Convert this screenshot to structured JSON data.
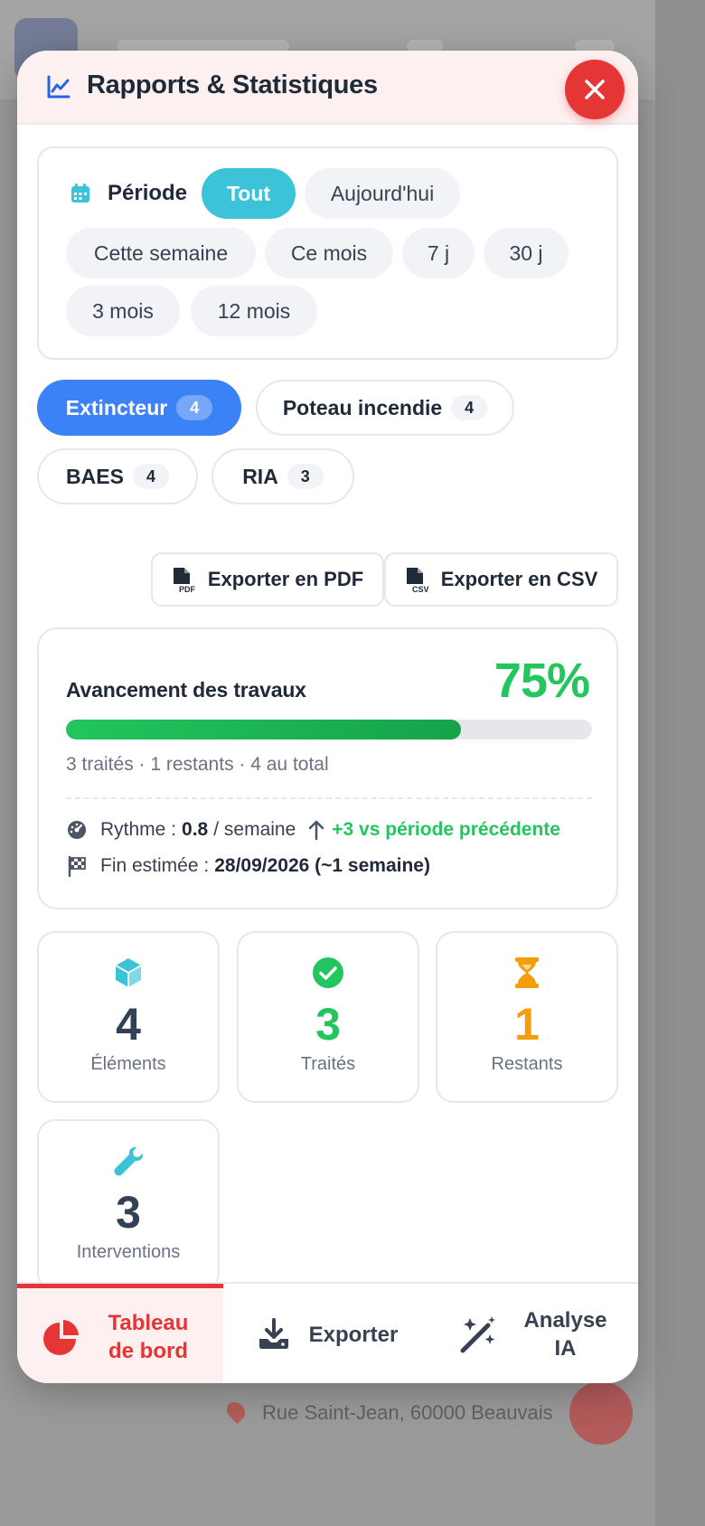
{
  "background": {
    "footer_address": "Rue Saint-Jean, 60000 Beauvais"
  },
  "header": {
    "title": "Rapports & Statistiques",
    "icon": "chart-line-icon",
    "close_icon": "close-icon"
  },
  "period": {
    "label": "Période",
    "options": [
      "Tout",
      "Aujourd'hui",
      "Cette semaine",
      "Ce mois",
      "7 j",
      "30 j",
      "3 mois",
      "12 mois"
    ],
    "selected": "Tout"
  },
  "types": [
    {
      "label": "Extincteur",
      "count": "4",
      "active": true
    },
    {
      "label": "Poteau incendie",
      "count": "4",
      "active": false
    },
    {
      "label": "BAES",
      "count": "4",
      "active": false
    },
    {
      "label": "RIA",
      "count": "3",
      "active": false
    }
  ],
  "export": {
    "pdf_label": "Exporter en PDF",
    "csv_label": "Exporter en CSV"
  },
  "progress": {
    "title": "Avancement des travaux",
    "percent_text": "75%",
    "fraction": 0.75,
    "summary": "3 traités · 1 restants · 4 au total",
    "rhythm_label": "Rythme :",
    "rhythm_value": "0.8",
    "rhythm_unit": "/ semaine",
    "trend": "+3 vs période précédente",
    "end_label": "Fin estimée :",
    "end_value": "28/09/2026 (~1 semaine)"
  },
  "stats": [
    {
      "value": "4",
      "label": "Éléments",
      "icon": "cube-icon",
      "color": "#334155"
    },
    {
      "value": "3",
      "label": "Traités",
      "icon": "check-circle-icon",
      "color": "#22c55e"
    },
    {
      "value": "1",
      "label": "Restants",
      "icon": "hourglass-icon",
      "color": "#f59e0b"
    },
    {
      "value": "3",
      "label": "Interventions",
      "icon": "wrench-icon",
      "color": "#334155"
    }
  ],
  "nav": {
    "dashboard": "Tableau de bord",
    "export": "Exporter",
    "ai": "Analyse IA"
  },
  "colors": {
    "accent_red": "#e53535",
    "chip_active": "#3cc3d9",
    "type_active": "#3b82f6",
    "success": "#22c55e",
    "warning": "#f59e0b"
  }
}
